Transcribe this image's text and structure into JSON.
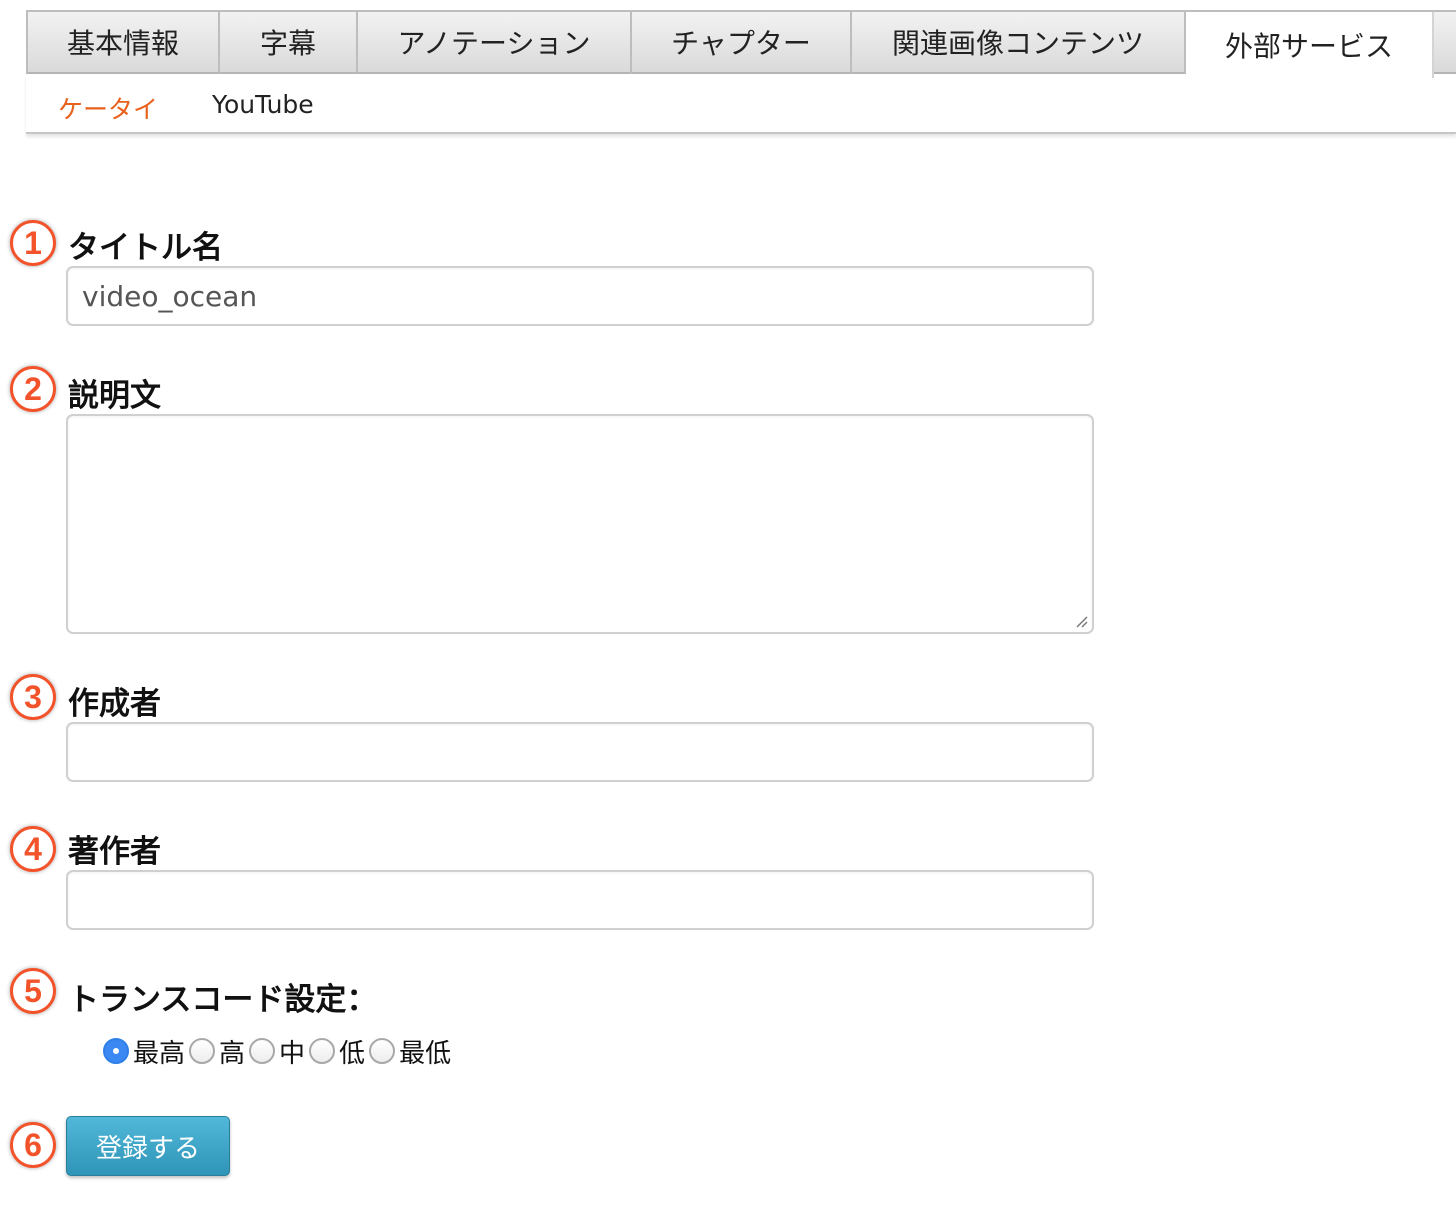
{
  "tabs": [
    {
      "label": "基本情報",
      "active": false
    },
    {
      "label": "字幕",
      "active": false
    },
    {
      "label": "アノテーション",
      "active": false
    },
    {
      "label": "チャプター",
      "active": false
    },
    {
      "label": "関連画像コンテンツ",
      "active": false
    },
    {
      "label": "外部サービス",
      "active": true
    }
  ],
  "subtabs": [
    {
      "label": "ケータイ",
      "active": true
    },
    {
      "label": "YouTube",
      "active": false
    }
  ],
  "form": {
    "title": {
      "number": "1",
      "label": "タイトル名",
      "value": "video_ocean"
    },
    "description": {
      "number": "2",
      "label": "説明文",
      "value": ""
    },
    "creator": {
      "number": "3",
      "label": "作成者",
      "value": ""
    },
    "author": {
      "number": "4",
      "label": "著作者",
      "value": ""
    },
    "transcode": {
      "number": "5",
      "label": "トランスコード設定：",
      "options": [
        "最高",
        "高",
        "中",
        "低",
        "最低"
      ],
      "selected": "最高"
    },
    "submit": {
      "number": "6",
      "label": "登録する"
    }
  },
  "colors": {
    "accent": "#e8611d",
    "marker": "#f3532a",
    "button": "#3aa3c6",
    "radio_checked": "#3b88f2"
  }
}
